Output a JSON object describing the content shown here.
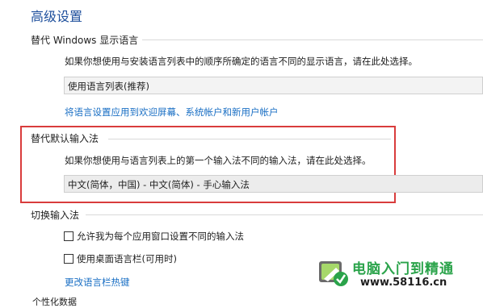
{
  "title": "高级设置",
  "display_language": {
    "heading": "替代 Windows 显示语言",
    "description": "如果你想使用与安装语言列表中的顺序所确定的语言不同的显示语言，请在此处选择。",
    "selected": "使用语言列表(推荐)",
    "link": "将语言设置应用到欢迎屏幕、系统帐户和新用户帐户"
  },
  "input_method": {
    "heading": "替代默认输入法",
    "description": "如果你想使用与语言列表上的第一个输入法不同的输入法，请在此处选择。",
    "selected": "中文(简体，中国) - 中文(简体) - 手心输入法"
  },
  "switch_input": {
    "heading": "切换输入法",
    "options": [
      {
        "label": "允许我为每个应用窗口设置不同的输入法",
        "checked": false
      },
      {
        "label": "使用桌面语言栏(可用时)",
        "checked": false
      }
    ],
    "link": "更改语言栏热键"
  },
  "next_section_partial": "个性化数据",
  "watermark": {
    "text_cn": "电脑入门到精通",
    "url": "www.58116.cn"
  },
  "colors": {
    "title": "#1e4f9c",
    "link": "#1a6fc4",
    "highlight": "#d93c3c",
    "watermark_green": "#2aa34a"
  }
}
